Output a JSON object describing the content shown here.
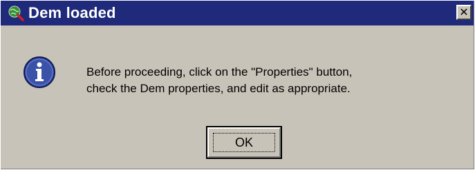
{
  "dialog": {
    "title": "Dem loaded",
    "close_glyph": "✕",
    "message_lines": [
      "Before proceeding, click on the \"Properties\" button,",
      "check the Dem properties, and edit as appropriate."
    ],
    "ok_label": "OK",
    "icons": {
      "title": "globe-magnifier-icon",
      "message": "info-icon",
      "close": "close-icon"
    },
    "colors": {
      "titlebar": "#1f2a7a",
      "body": "#c8c3b8",
      "info_blue": "#3a52a8"
    }
  }
}
